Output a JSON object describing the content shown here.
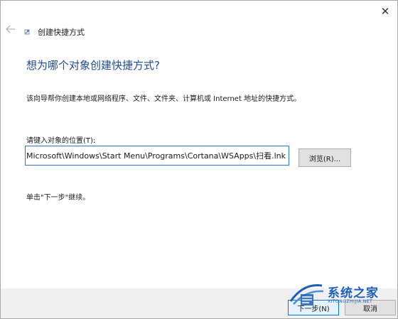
{
  "window": {
    "title": "创建快捷方式",
    "close_glyph": "✕"
  },
  "heading": "想为哪个对象创建快捷方式?",
  "description": "该向导帮你创建本地或网络程序、文件、文件夹、计算机或 Internet 地址的快捷方式。",
  "location": {
    "label": "请键入对象的位置(T):",
    "value": "Microsoft\\Windows\\Start Menu\\Programs\\Cortana\\WSApps\\扫看.lnk"
  },
  "browse_label": "浏览(R)...",
  "hint": "单击\"下一步\"继续。",
  "footer": {
    "next_label": "下一步(N)",
    "cancel_label": "取消"
  },
  "watermark": {
    "brand": "系统之家",
    "url": "XITONGZHIJIA.NET"
  },
  "colors": {
    "heading": "#1f4a92",
    "accent": "#0078d7",
    "watermark": "#1d5fb8"
  },
  "icons": [
    "back-arrow-icon",
    "shortcut-app-icon",
    "close-icon",
    "watermark-logo-icon"
  ]
}
